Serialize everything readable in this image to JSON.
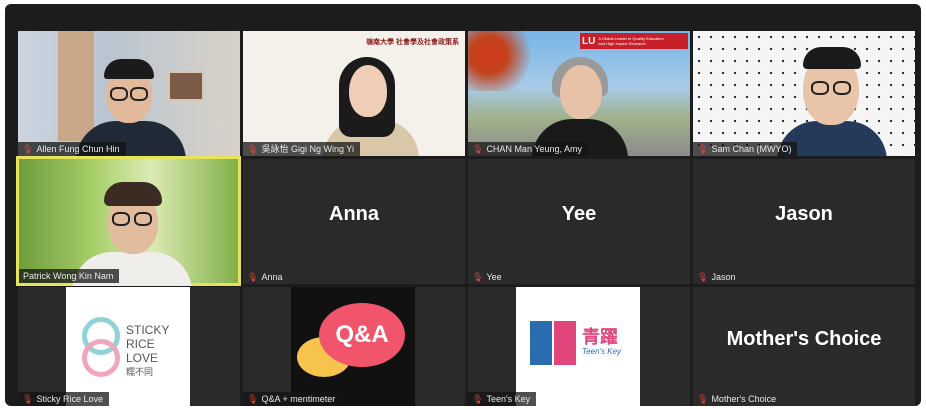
{
  "participants": [
    {
      "name": "Allen Fung Chun Hin",
      "display": "video"
    },
    {
      "name": "吳詠怡 Gigi Ng Wing Yi",
      "display": "video",
      "banner": "嶺南大學 社會學及社會政策系"
    },
    {
      "name": "CHAN Man Yeung, Amy",
      "display": "video",
      "banner_logo": "LU",
      "banner_line1": "A Global Leader in Quality Education",
      "banner_line2": "and High Impact Research"
    },
    {
      "name": "Sam Chan (MWYO)",
      "display": "video"
    },
    {
      "name": "Patrick Wong Kin Nam",
      "display": "video"
    },
    {
      "name": "Anna",
      "display": "name"
    },
    {
      "name": "Yee",
      "display": "name"
    },
    {
      "name": "Jason",
      "display": "name"
    },
    {
      "name": "Sticky Rice Love",
      "display": "logo",
      "logo_lines": [
        "STICKY",
        "RICE",
        "LOVE"
      ],
      "logo_cn": "糯不同"
    },
    {
      "name": "Q&A + mentimeter",
      "display": "logo",
      "logo_text": "Q&A"
    },
    {
      "name": "Teen's Key",
      "display": "logo",
      "logo_cn": "青躍",
      "logo_en": "Teen's Key"
    },
    {
      "name": "Mother's Choice",
      "display": "name"
    }
  ],
  "colors": {
    "background": "#1c1c1c",
    "tile": "#2a2a2a",
    "active_speaker_border": "#e6e25a",
    "mic_muted": "#e0463d",
    "qa_bubble_pink": "#f0556b",
    "qa_bubble_yellow": "#f6c34c",
    "teenskey_blue": "#2b6cb0",
    "teenskey_pink": "#e0457b"
  },
  "icons": {
    "mic": "mic-muted-icon"
  }
}
